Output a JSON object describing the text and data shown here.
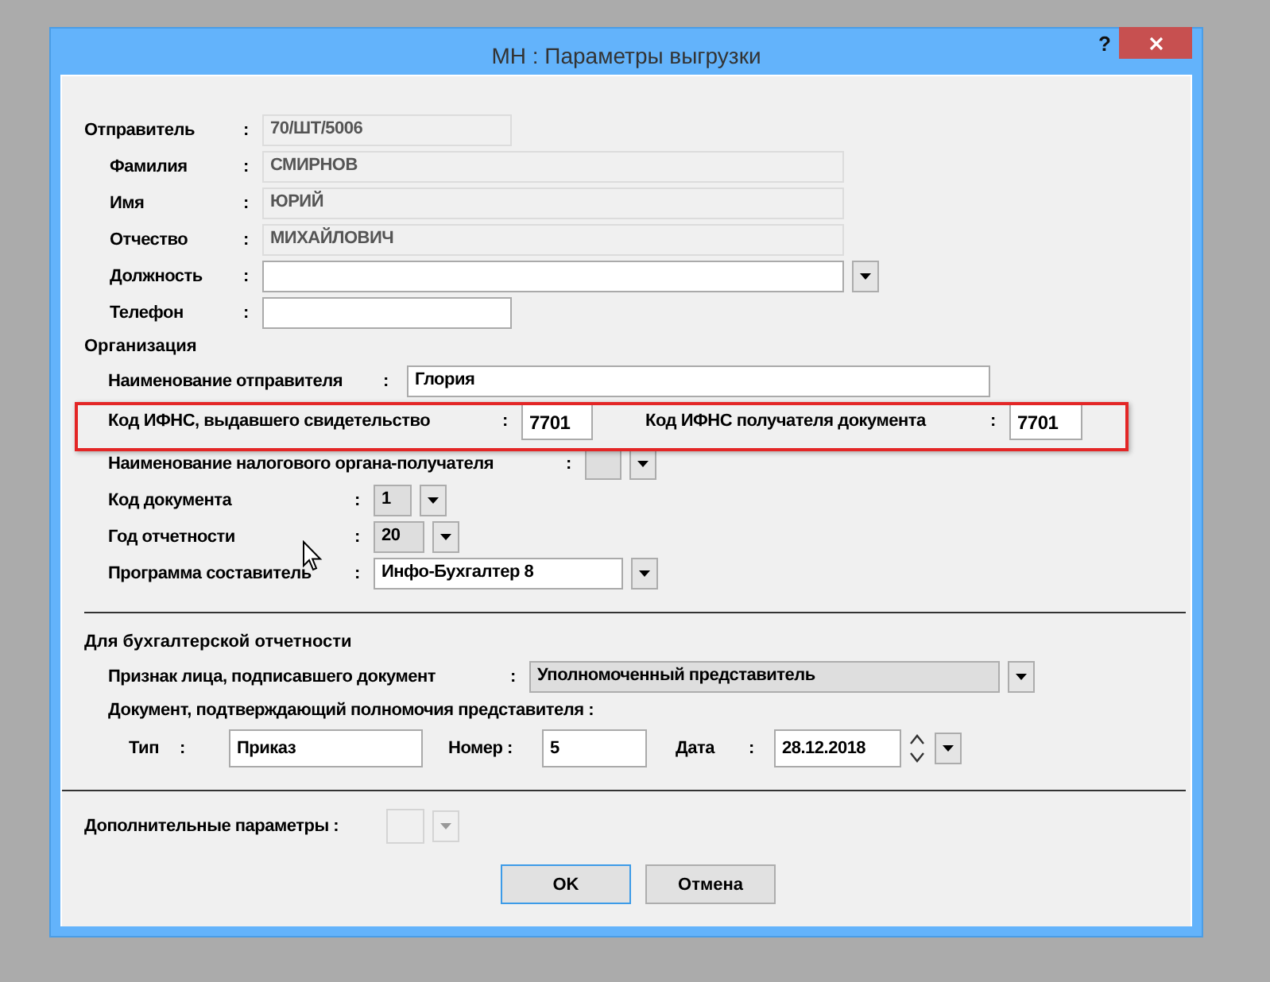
{
  "window": {
    "title": "МН : Параметры выгрузки",
    "help": "?"
  },
  "sender": [
    {
      "label": "Отправитель",
      "colon": ":",
      "value": "70/ШТ/5006",
      "kind": "text",
      "disabled": true
    },
    {
      "label": "Фамилия",
      "colon": ":",
      "value": "СМИРНОВ",
      "kind": "text",
      "disabled": true
    },
    {
      "label": "Имя",
      "colon": ":",
      "value": "ЮРИЙ",
      "kind": "text",
      "disabled": true
    },
    {
      "label": "Отчество",
      "colon": ":",
      "value": "МИХАЙЛОВИЧ",
      "kind": "text",
      "disabled": true
    },
    {
      "label": "Должность",
      "colon": ":",
      "kind": "combo",
      "disabled": false
    },
    {
      "label": "Телефон",
      "colon": ":",
      "kind": "text",
      "disabled": false
    }
  ],
  "organization": {
    "title": "Организация",
    "sender_name": {
      "label": "Наименование отправителя",
      "colon": ":",
      "value": "Глория"
    },
    "codes": [
      {
        "label": "Код ИФНС, выдавшего свидетельство",
        "colon": ":",
        "value": "7701"
      },
      {
        "label": "Код ИФНС получателя документа",
        "colon": ":",
        "value": "7701"
      }
    ],
    "rows": [
      {
        "label": "Наименование налогового органа-получателя",
        "colon": ":",
        "kind": "dropdown"
      },
      {
        "label": "Код документа",
        "colon": ":",
        "value": "1",
        "kind": "dropdown"
      },
      {
        "label": "Год отчетности",
        "colon": ":",
        "value": "20",
        "kind": "dropdown"
      },
      {
        "label": "Программа составитель",
        "colon": ":",
        "value": "Инфо-Бухгалтер 8",
        "kind": "combo"
      }
    ]
  },
  "accounting": {
    "title": "Для бухгалтерской отчетности",
    "signer": {
      "label": "Признак лица, подписавшего документ",
      "colon": ":",
      "value": "Уполномоченный представитель",
      "kind": "dropdown"
    },
    "document_label": "Документ, подтверждающий  полномочия представителя  :",
    "type": {
      "label": "Тип",
      "colon": ":",
      "value": "Приказ"
    },
    "number": {
      "label": "Номер :",
      "value": "5"
    },
    "date": {
      "label": "Дата",
      "colon": ":",
      "value": "28.12.2018"
    }
  },
  "extra": {
    "label": "Дополнительные параметры :",
    "disabled": true
  },
  "buttons": [
    {
      "label": "OK",
      "default": true
    },
    {
      "label": "Отмена",
      "default": false
    }
  ]
}
